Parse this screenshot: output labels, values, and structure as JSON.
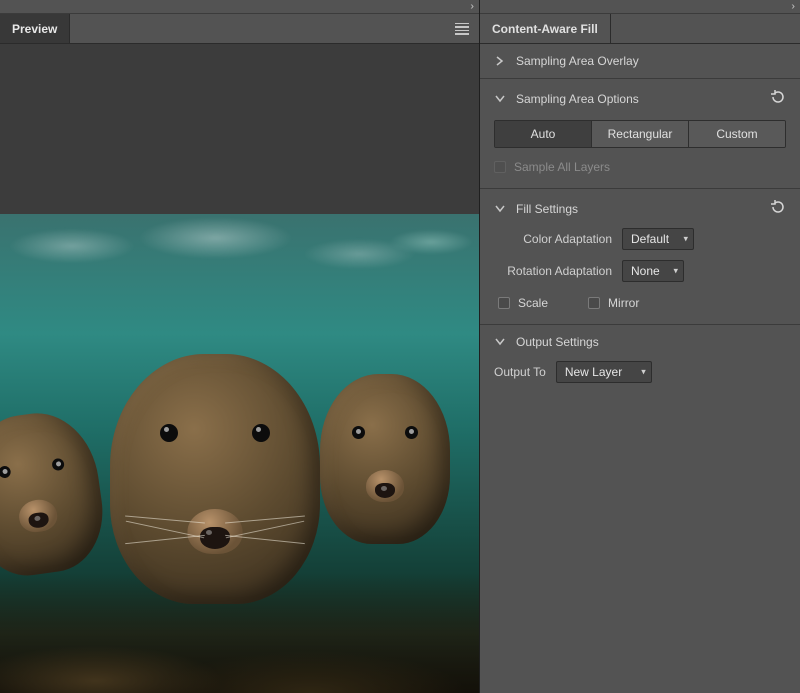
{
  "left": {
    "tab_label": "Preview"
  },
  "right": {
    "tab_label": "Content-Aware Fill",
    "sections": {
      "overlay": {
        "title": "Sampling Area Overlay"
      },
      "sampling": {
        "title": "Sampling Area Options",
        "segs": {
          "auto": "Auto",
          "rect": "Rectangular",
          "custom": "Custom"
        },
        "sample_all_layers": "Sample All Layers"
      },
      "fill": {
        "title": "Fill Settings",
        "color_adaptation_label": "Color Adaptation",
        "color_adaptation_value": "Default",
        "rotation_adaptation_label": "Rotation Adaptation",
        "rotation_adaptation_value": "None",
        "scale": "Scale",
        "mirror": "Mirror"
      },
      "output": {
        "title": "Output Settings",
        "output_to_label": "Output To",
        "output_to_value": "New Layer"
      }
    }
  }
}
